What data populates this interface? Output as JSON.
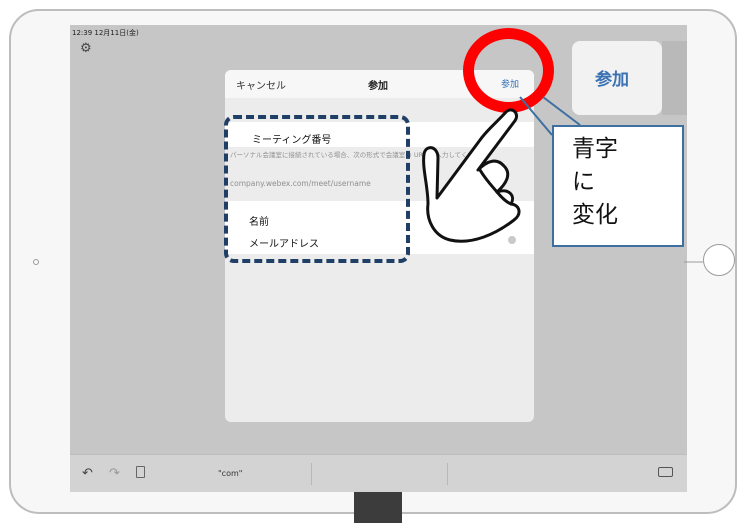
{
  "status_bar": {
    "time": "12:39 12月11日(金)"
  },
  "icons": {
    "settings": "gear-icon",
    "undo": "undo-icon",
    "redo": "redo-icon",
    "paste": "paste-icon",
    "hide_keyboard": "keyboard-hide-icon",
    "clear": "clear-icon",
    "tap_hand": "pointing-hand-icon"
  },
  "background": {
    "join_label": "参加"
  },
  "modal": {
    "cancel_label": "キャンセル",
    "title": "参加",
    "join_label": "参加",
    "meeting_number_label": "ミーティング番号",
    "hint": "パーソナル会議室に接続されている場合、次の形式で会議室の URL を入力してください。",
    "url_example": "company.webex.com/meet/username",
    "name_placeholder": "名前",
    "email_placeholder": "メールアドレス"
  },
  "keyboard": {
    "suggestion": "\"com\""
  },
  "annotation": {
    "callout_text": "青字\nに\n変化"
  },
  "colors": {
    "accent_blue": "#2f6db6",
    "highlight_red": "#ff0000",
    "dashed_navy": "#1f3f66"
  }
}
